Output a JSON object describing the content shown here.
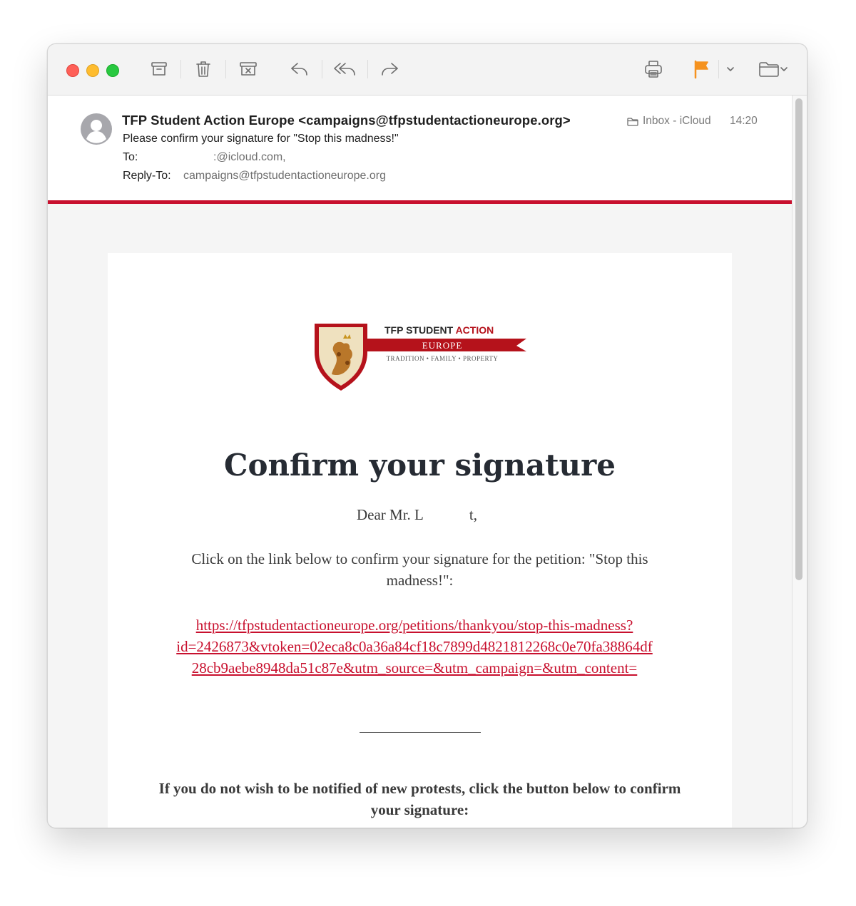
{
  "toolbar": {
    "buttons": [
      "archive-icon",
      "trash-icon",
      "junk-icon",
      "reply-icon",
      "reply-all-icon",
      "forward-icon",
      "print-icon",
      "flag-icon",
      "move-folder-icon"
    ],
    "flag_color": "#f5921e"
  },
  "message": {
    "from": "TFP Student Action Europe <campaigns@tfpstudentactioneurope.org>",
    "subject": "Please confirm your signature for \"Stop this madness!\"",
    "to_label": "To:",
    "to_value": ":@icloud.com,",
    "reply_to_label": "Reply-To:",
    "reply_to_value": "campaigns@tfpstudentactioneurope.org",
    "mailbox": "Inbox - iCloud",
    "time": "14:20"
  },
  "logo": {
    "line1_a": "TFP STUDENT",
    "line1_b": "ACTION",
    "ribbon": "EUROPE",
    "motto": "Tradition • Family • Property"
  },
  "email": {
    "title": "Confirm your signature",
    "greeting_start": "Dear Mr. L",
    "greeting_end": "t,",
    "paragraph": "Click on the link below to confirm your signature for the petition: \"Stop this madness!\":",
    "link": "https://tfpstudentactioneurope.org/petitions/thankyou/stop-this-madness?\nid=2426873&vtoken=02eca8c0a36a84cf18c7899d4821812268c0e70fa38864df\n28cb9aebe8948da51c87e&utm_source=&utm_campaign=&utm_content=",
    "notice": "If you do not wish to be notified of new protests, click the button below to confirm your signature:"
  },
  "colors": {
    "accent_red": "#c8102e",
    "title": "#262b33"
  }
}
